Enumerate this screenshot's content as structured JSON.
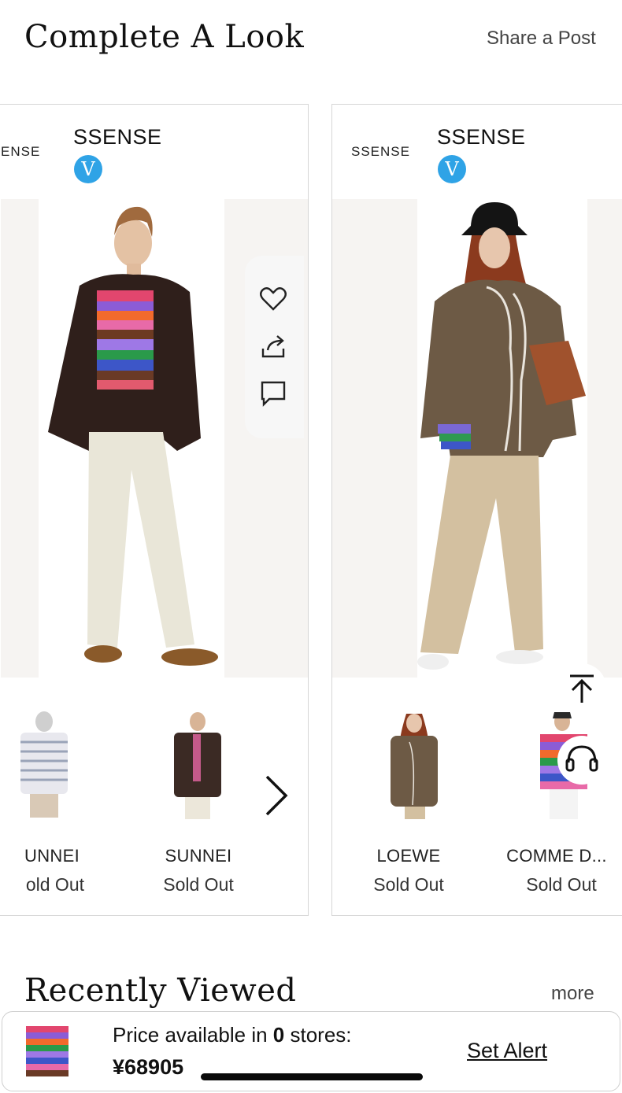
{
  "complete_look": {
    "title": "Complete A Look",
    "share_label": "Share a Post"
  },
  "cards": [
    {
      "logo_text": "ENSE",
      "brand": "SSENSE",
      "verified_label": "V",
      "products": [
        {
          "brand": "UNNEI",
          "status": "old Out"
        },
        {
          "brand": "SUNNEI",
          "status": "Sold Out"
        }
      ]
    },
    {
      "logo_text": "SSENSE",
      "brand": "SSENSE",
      "verified_label": "V",
      "products": [
        {
          "brand": "LOEWE",
          "status": "Sold Out"
        },
        {
          "brand": "COMME D...",
          "status": "Sold Out"
        }
      ]
    }
  ],
  "icons": [
    "heart-icon",
    "share-icon",
    "comment-icon",
    "chevron-right-icon",
    "back-to-top-icon",
    "headset-icon"
  ],
  "recently_viewed": {
    "title": "Recently Viewed",
    "more_label": "more"
  },
  "price_bar": {
    "prefix": "Price available in ",
    "store_count": "0",
    "suffix": " stores:",
    "price": "¥68905",
    "alert_label": "Set Alert"
  },
  "colors": {
    "verified_blue": "#2fa3e6",
    "border": "#d6d6d6"
  }
}
